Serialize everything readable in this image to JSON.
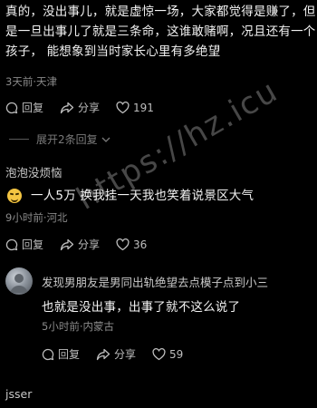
{
  "comment1": {
    "lines": [
      "真的，没出事儿，就是虚惊一场，大家都觉得是赚了，但",
      "是一旦出事儿了就是三条命，这谁敢赌啊，况且还有一个",
      "孩子，  能想象到当时家长心里有多绝望"
    ],
    "meta": "3天前·天津",
    "reply_label": "回复",
    "share_label": "分享",
    "like_count": "191"
  },
  "expand_replies": "展开2条回复",
  "comment2": {
    "username": "泡泡没烦恼",
    "text": "一人5万 换我挂一天我也笑着说景区大气",
    "meta": "9小时前·河北",
    "reply_label": "回复",
    "share_label": "分享",
    "like_count": "36"
  },
  "comment3": {
    "username": "发现男朋友是男同出轨绝望去点模子点到小三",
    "text": "也就是没出事，出事了就不这么说了",
    "meta": "5小时前·内蒙古",
    "reply_label": "回复",
    "share_label": "分享",
    "like_count": "59"
  },
  "next_user": "jsser",
  "watermark": "https://hz.icu",
  "colors": {
    "background": "#000000",
    "text": "#f2f2f2",
    "meta": "#8a8a8a"
  }
}
